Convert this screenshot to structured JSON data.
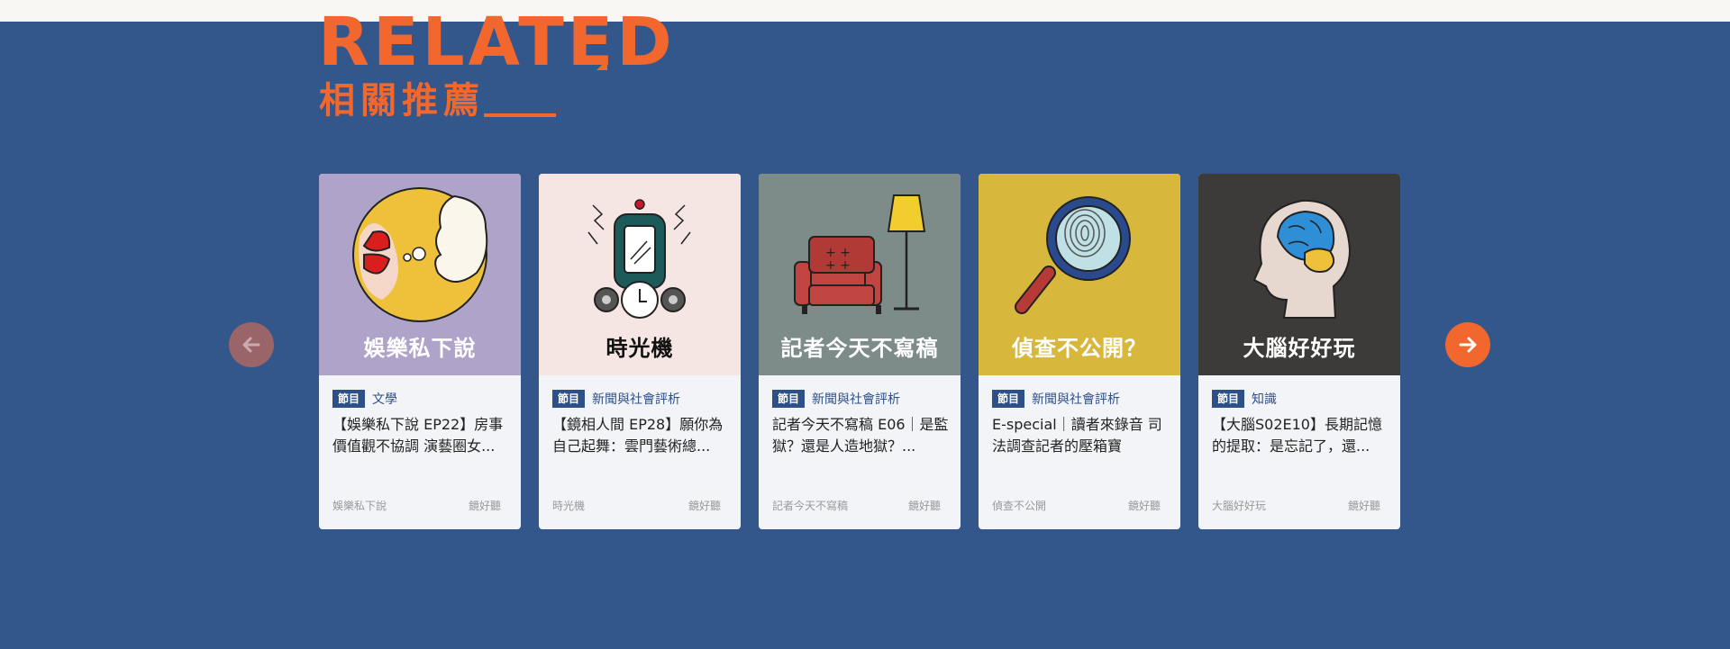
{
  "section": {
    "heading_en": "RELATED",
    "heading_zh": "相關推薦"
  },
  "nav": {
    "prev_icon": "arrow-left-icon",
    "next_icon": "arrow-right-icon",
    "prev_color": "#9a6569",
    "next_color": "#f2672e"
  },
  "cards": [
    {
      "thumb_title": "娛樂私下說",
      "thumb_bg": "#b0a3c9",
      "thumb_title_color": "#ffffff",
      "tag": "節目",
      "category": "文學",
      "title": "【娛樂私下說 EP22】房事價值觀不協調 演藝圈女...",
      "program": "娛樂私下說",
      "source": "鏡好聽"
    },
    {
      "thumb_title": "時光機",
      "thumb_bg": "#f5e6e4",
      "thumb_title_color": "#111111",
      "tag": "節目",
      "category": "新聞與社會評析",
      "title": "【鏡相人間 EP28】願你為自己起舞：雲門藝術總...",
      "program": "時光機",
      "source": "鏡好聽"
    },
    {
      "thumb_title": "記者今天不寫稿",
      "thumb_bg": "#7d8b89",
      "thumb_title_color": "#ffffff",
      "tag": "節目",
      "category": "新聞與社會評析",
      "title": "記者今天不寫稿 E06｜是監獄？還是人造地獄？...",
      "program": "記者今天不寫稿",
      "source": "鏡好聽"
    },
    {
      "thumb_title": "偵查不公開？",
      "thumb_bg": "#d7b73c",
      "thumb_title_color": "#ffffff",
      "tag": "節目",
      "category": "新聞與社會評析",
      "title": "E-special｜讀者來錄音 司法調查記者的壓箱寶",
      "program": "偵查不公開",
      "source": "鏡好聽"
    },
    {
      "thumb_title": "大腦好好玩",
      "thumb_bg": "#3c3b39",
      "thumb_title_color": "#ffffff",
      "tag": "節目",
      "category": "知識",
      "title": "【大腦S02E10】長期記憶的提取：是忘記了，還...",
      "program": "大腦好好玩",
      "source": "鏡好聽"
    }
  ]
}
